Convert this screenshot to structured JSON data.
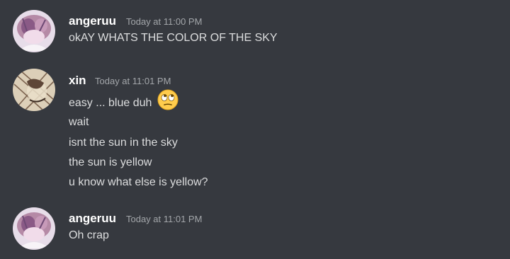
{
  "messages": [
    {
      "author": "angeruu",
      "timestamp": "Today at 11:00 PM",
      "lines": [
        "okAY WHATS THE COLOR OF THE SKY"
      ]
    },
    {
      "author": "xin",
      "timestamp": "Today at 11:01 PM",
      "lines": [
        "easy ... blue duh",
        "wait",
        "isnt the sun in the sky",
        "the sun is yellow",
        "u know what else is yellow?"
      ],
      "emoji": "face-with-rolling-eyes"
    },
    {
      "author": "angeruu",
      "timestamp": "Today at 11:01 PM",
      "lines": [
        "Oh crap"
      ]
    }
  ],
  "colors": {
    "background": "#36393f",
    "username": "#ffffff",
    "timestamp": "#a3a6aa",
    "message_text": "#dcddde"
  }
}
